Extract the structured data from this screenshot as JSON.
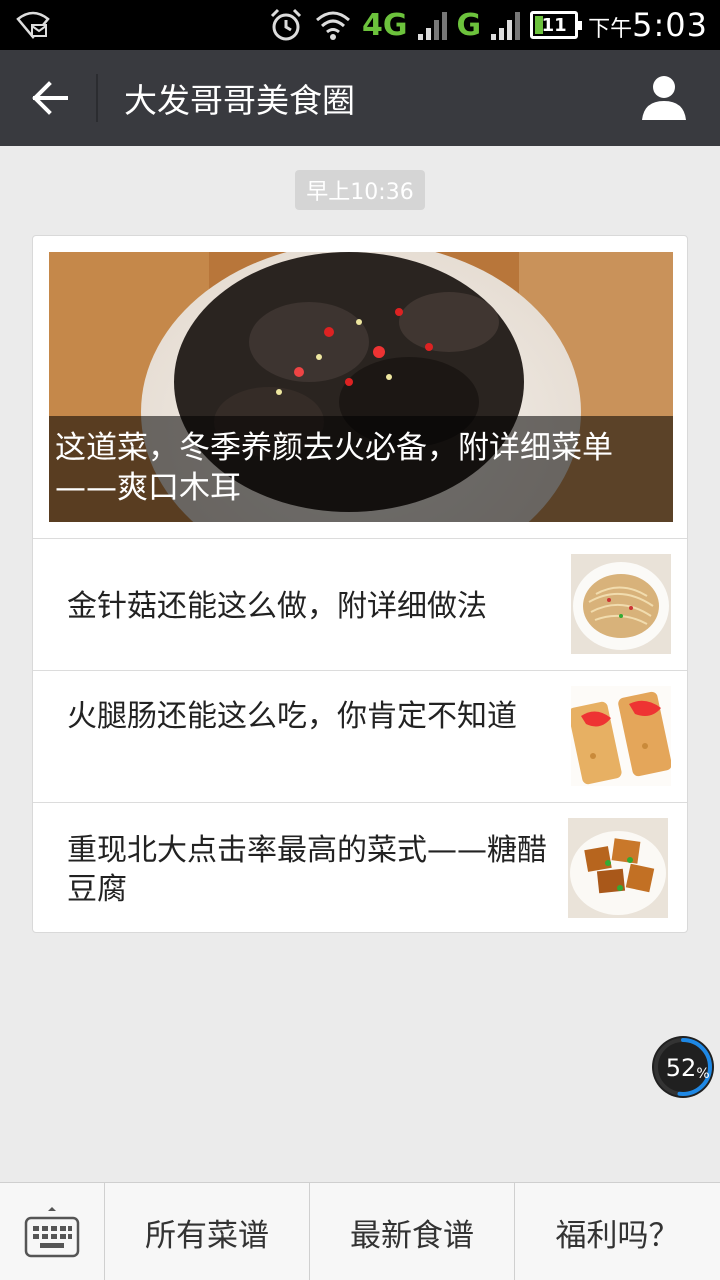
{
  "status_bar": {
    "network_primary": "4G",
    "network_secondary": "G",
    "battery_level": "11",
    "time_prefix": "下午",
    "time": "5:03"
  },
  "header": {
    "title": "大发哥哥美食圈",
    "back_icon": "back-arrow-icon",
    "profile_icon": "profile-icon"
  },
  "chat": {
    "timestamp": "早上10:36"
  },
  "article_card": {
    "cover_title": "这道菜，冬季养颜去火必备，附详细菜单——爽口木耳",
    "items": [
      {
        "title": "金针菇还能这么做，附详细做法"
      },
      {
        "title": "火腿肠还能这么吃，你肯定不知道"
      },
      {
        "title": "重现北大点击率最高的菜式——糖醋豆腐"
      }
    ]
  },
  "floating_badge": {
    "percent_value": 52,
    "percent_number": "52",
    "percent_sign": "%"
  },
  "bottom_menu": {
    "keyboard_icon": "keyboard-icon",
    "buttons": [
      {
        "label": "所有菜谱"
      },
      {
        "label": "最新食谱"
      },
      {
        "label": "福利吗？"
      }
    ]
  },
  "colors": {
    "titlebar_bg": "#393a3f",
    "page_bg": "#ebebeb",
    "status_green": "#6cc23c",
    "badge_ring": "#1e88e5"
  }
}
